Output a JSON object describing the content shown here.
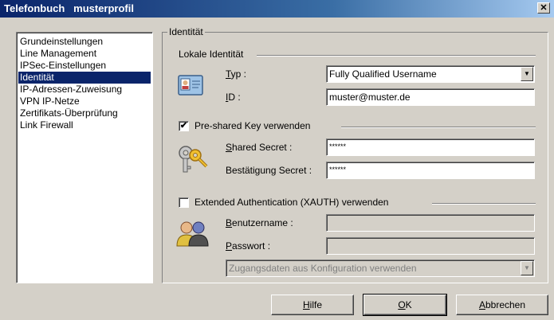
{
  "window": {
    "title": "Telefonbuch   musterprofil",
    "close_glyph": "✕"
  },
  "sidebar": {
    "items": [
      {
        "label": "Grundeinstellungen",
        "selected": false
      },
      {
        "label": "Line Management",
        "selected": false
      },
      {
        "label": "IPSec-Einstellungen",
        "selected": false
      },
      {
        "label": "Identität",
        "selected": true
      },
      {
        "label": "IP-Adressen-Zuweisung",
        "selected": false
      },
      {
        "label": "VPN IP-Netze",
        "selected": false
      },
      {
        "label": "Zertifikats-Überprüfung",
        "selected": false
      },
      {
        "label": "Link Firewall",
        "selected": false
      }
    ]
  },
  "identity": {
    "group_title": "Identität",
    "local_title": "Lokale Identität",
    "type_label_accel": "T",
    "type_label_rest": "yp :",
    "type_value": "Fully Qualified Username",
    "id_label_accel": "I",
    "id_label_rest": "D :",
    "id_value": "muster@muster.de"
  },
  "psk": {
    "checked": true,
    "check_glyph": "✔",
    "label": "Pre-shared Key verwenden",
    "secret_label_accel": "S",
    "secret_label_rest": "hared Secret :",
    "secret_value": "******",
    "confirm_label": "Bestätigung Secret :",
    "confirm_value": "******"
  },
  "xauth": {
    "checked": false,
    "label": "Extended Authentication (XAUTH) verwenden",
    "user_label_accel": "B",
    "user_label_rest": "enutzername :",
    "user_value": "",
    "pass_label_accel": "P",
    "pass_label_rest": "asswort :",
    "pass_value": "",
    "source_value": "Zugangsdaten aus Konfiguration verwenden"
  },
  "buttons": {
    "help_accel": "H",
    "help_rest": "ilfe",
    "ok_accel": "O",
    "ok_rest": "K",
    "cancel_accel": "A",
    "cancel_rest": "bbrechen"
  },
  "colors": {
    "title_bar": "#0a246a",
    "selection": "#0a246a",
    "face": "#d4d0c8"
  },
  "icons": [
    "id-card-icon",
    "keys-icon",
    "users-icon",
    "chevron-down-icon",
    "close-icon"
  ]
}
